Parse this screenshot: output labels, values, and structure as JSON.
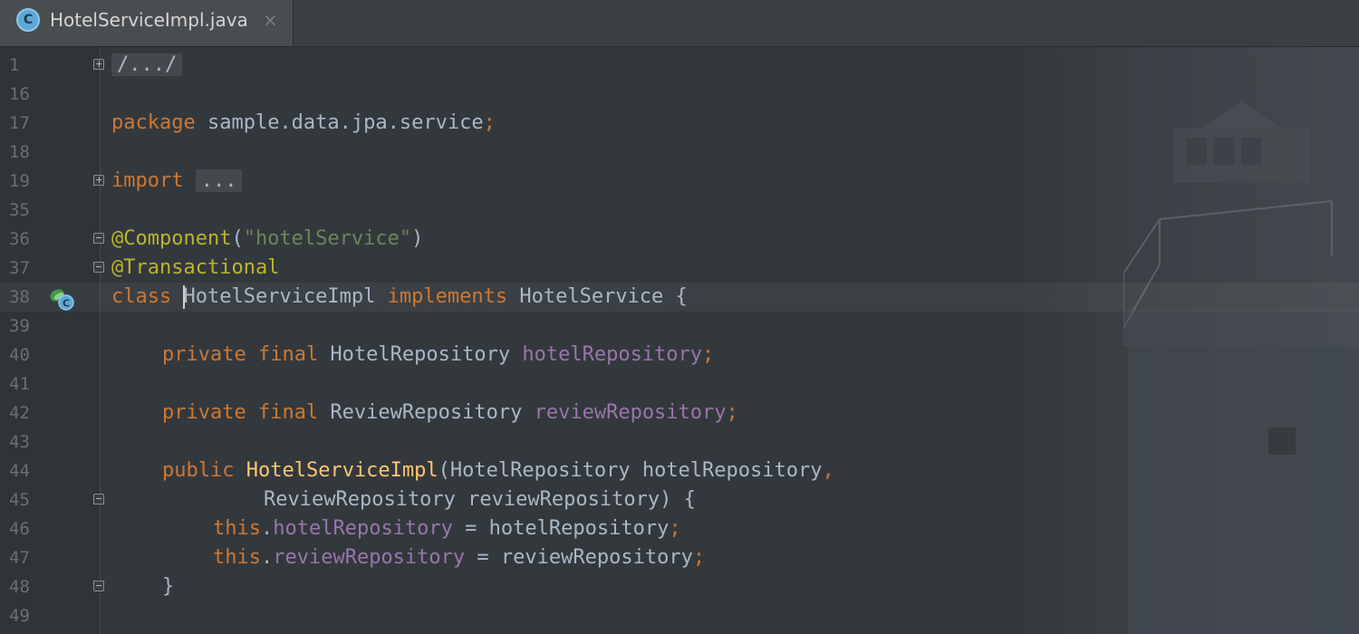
{
  "tab": {
    "icon": "class-icon",
    "icon_letter": "C",
    "title": "HotelServiceImpl.java",
    "close": "×"
  },
  "lines": [
    {
      "n": "1"
    },
    {
      "n": "16"
    },
    {
      "n": "17"
    },
    {
      "n": "18"
    },
    {
      "n": "19"
    },
    {
      "n": "35"
    },
    {
      "n": "36"
    },
    {
      "n": "37"
    },
    {
      "n": "38"
    },
    {
      "n": "39"
    },
    {
      "n": "40"
    },
    {
      "n": "41"
    },
    {
      "n": "42"
    },
    {
      "n": "43"
    },
    {
      "n": "44"
    },
    {
      "n": "45"
    },
    {
      "n": "46"
    },
    {
      "n": "47"
    },
    {
      "n": "48"
    },
    {
      "n": "49"
    }
  ],
  "code": {
    "l1": "/.../",
    "l17_kw": "package",
    "l17_pkg": " sample.data.jpa.service",
    "l17_semi": ";",
    "l19_kw": "import",
    "l19_fold": "...",
    "l36_ann": "@Component",
    "l36_p1": "(",
    "l36_str": "\"hotelService\"",
    "l36_p2": ")",
    "l37_ann": "@Transactional",
    "l38_kw1": "class",
    "l38_name": "HotelServiceImpl",
    "l38_kw2": "implements",
    "l38_iface": " HotelService {",
    "l40_kw": "private final",
    "l40_type": " HotelRepository ",
    "l40_fld": "hotelRepository",
    "l40_semi": ";",
    "l42_kw": "private final",
    "l42_type": " ReviewRepository ",
    "l42_fld": "reviewRepository",
    "l42_semi": ";",
    "l44_kw": "public",
    "l44_fn": "HotelServiceImpl",
    "l44_rest": "(HotelRepository hotelRepository",
    "l44_comma": ",",
    "l45_rest": "ReviewRepository reviewRepository) {",
    "l46_this": "this",
    "l46_dot": ".",
    "l46_fld": "hotelRepository",
    "l46_rest": " = hotelRepository",
    "l46_semi": ";",
    "l47_this": "this",
    "l47_dot": ".",
    "l47_fld": "reviewRepository",
    "l47_rest": " = reviewRepository",
    "l47_semi": ";",
    "l48_brace": "}"
  },
  "colors": {
    "keyword": "#cc7832",
    "annotation": "#bbb529",
    "string": "#6a8759",
    "field": "#9876aa",
    "method": "#ffc66d",
    "text": "#a9b7c6"
  }
}
